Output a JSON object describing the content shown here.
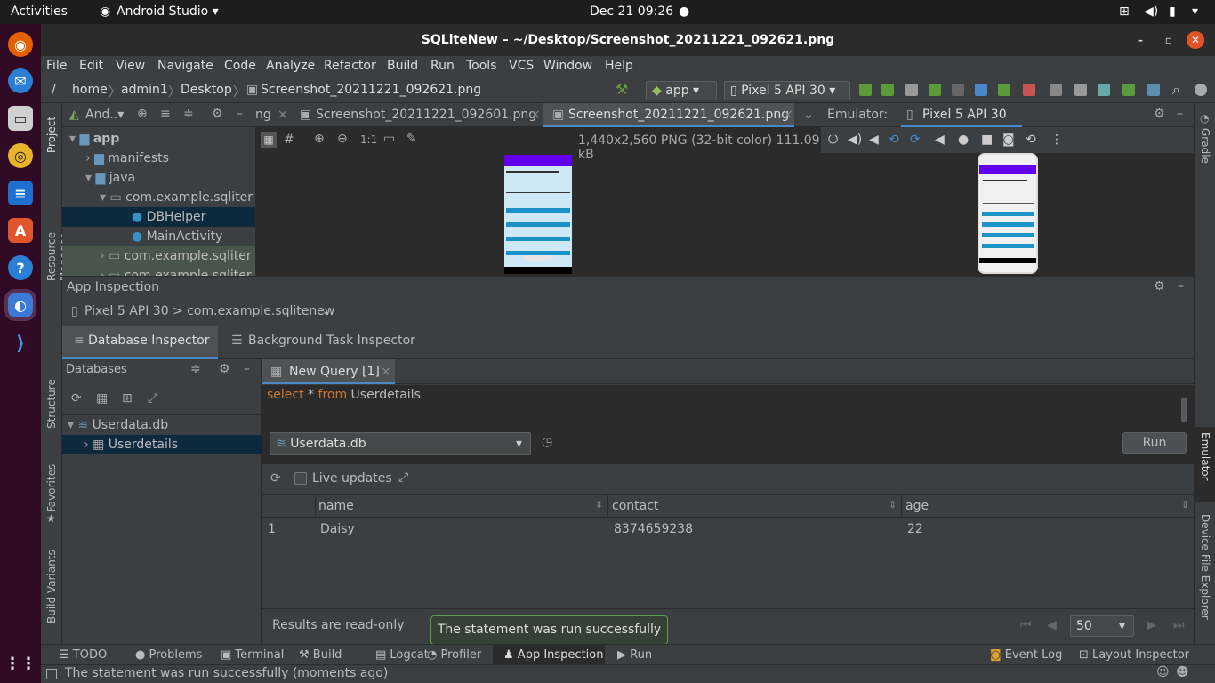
{
  "topbar": {
    "activities": "Activities",
    "app": "Android Studio ▾",
    "clock": "Dec 21  09:26"
  },
  "window": {
    "title": "SQLiteNew – ~/Desktop/Screenshot_20211221_092621.png"
  },
  "menu": [
    "File",
    "Edit",
    "View",
    "Navigate",
    "Code",
    "Analyze",
    "Refactor",
    "Build",
    "Run",
    "Tools",
    "VCS",
    "Window",
    "Help"
  ],
  "breadcrumb": {
    "root": "/",
    "items": [
      "home",
      "admin1",
      "Desktop"
    ],
    "file": "Screenshot_20211221_092621.png"
  },
  "run_config": {
    "module": "app",
    "device": "Pixel 5 API 30"
  },
  "left_strip": {
    "project": "Project",
    "resource_manager": "Resource Manager",
    "structure": "Structure",
    "favorites": "Favorites",
    "build_variants": "Build Variants"
  },
  "right_strip": {
    "gradle": "Gradle",
    "emulator": "Emulator",
    "device_file_explorer": "Device File Explorer"
  },
  "project_panel": {
    "header": "And..▾",
    "tree": [
      {
        "label": "app",
        "depth": 0
      },
      {
        "label": "manifests",
        "depth": 1
      },
      {
        "label": "java",
        "depth": 1
      },
      {
        "label": "com.example.sqliter",
        "depth": 2
      },
      {
        "label": "DBHelper",
        "depth": 3
      },
      {
        "label": "MainActivity",
        "depth": 3
      },
      {
        "label": "com.example.sqliter",
        "depth": 2
      },
      {
        "label": "com.example.sqliter",
        "depth": 2
      }
    ]
  },
  "editor": {
    "tabs": [
      "ng",
      "Screenshot_20211221_092601.png",
      "Screenshot_20211221_092621.png"
    ],
    "zoom_label": "1:1",
    "image_info": "1,440x2,560 PNG (32-bit color) 111.09 kB"
  },
  "emulator": {
    "label": "Emulator:",
    "device_tab": "Pixel 5 API 30"
  },
  "app_inspection": {
    "title": "App Inspection",
    "process": "Pixel 5 API 30 > com.example.sqlitenew",
    "tabs": [
      "Database Inspector",
      "Background Task Inspector"
    ],
    "databases_label": "Databases",
    "db_tree": {
      "db": "Userdata.db",
      "table": "Userdetails"
    },
    "query_tab": "New Query [1]",
    "query": {
      "kw1": "select",
      "star": " * ",
      "kw2": "from",
      "table": " Userdetails"
    },
    "db_select": "Userdata.db",
    "run_label": "Run",
    "live_updates": "Live updates",
    "columns": [
      "name",
      "contact",
      "age"
    ],
    "rows": [
      {
        "index": "1",
        "name": "Daisy",
        "contact": "8374659238",
        "age": "22"
      }
    ],
    "readonly": "Results are read-only",
    "toast": "The statement was run successfully",
    "page_size": "50"
  },
  "bottom_tools": [
    "TODO",
    "Problems",
    "Terminal",
    "Build",
    "Logcat",
    "Profiler",
    "App Inspection",
    "Run"
  ],
  "bottom_tools_right": [
    "Event Log",
    "Layout Inspector"
  ],
  "status": "The statement was run successfully (moments ago)",
  "colors": {
    "accent": "#4a88c7",
    "keyword": "#cc7832",
    "selection": "#0d293e",
    "toast_border": "#5e9a4e"
  }
}
